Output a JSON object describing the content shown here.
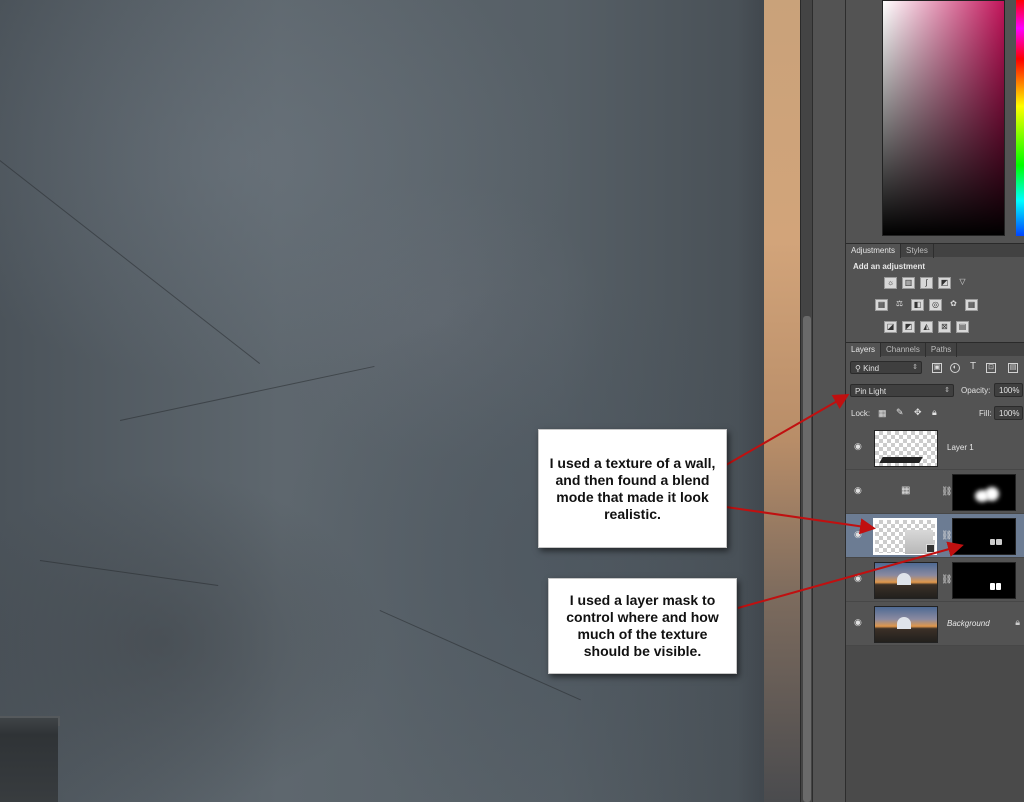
{
  "adjustments": {
    "tabs": [
      "Adjustments",
      "Styles"
    ],
    "title": "Add an adjustment",
    "icon_rows": [
      [
        "brightness-contrast-icon",
        "levels-icon",
        "curves-icon",
        "exposure-icon",
        "vibrance-icon"
      ],
      [
        "hue-saturation-icon",
        "color-balance-icon",
        "black-white-icon",
        "photo-filter-icon",
        "channel-mixer-icon",
        "color-lookup-icon"
      ],
      [
        "invert-icon",
        "posterize-icon",
        "threshold-icon",
        "selective-color-icon",
        "gradient-map-icon"
      ]
    ]
  },
  "layers_panel": {
    "tabs": [
      "Layers",
      "Channels",
      "Paths"
    ],
    "filter_kind": "Kind",
    "blend_mode": "Pin Light",
    "opacity_label": "Opacity:",
    "opacity_value": "100%",
    "lock_label": "Lock:",
    "fill_label": "Fill:",
    "fill_value": "100%",
    "layers": [
      {
        "name": "Layer 1",
        "type": "pixel"
      },
      {
        "name": "",
        "type": "adjustment-with-mask"
      },
      {
        "name": "",
        "type": "smart-object-with-mask",
        "selected": true
      },
      {
        "name": "",
        "type": "photo-with-mask"
      },
      {
        "name": "Background",
        "type": "background",
        "locked": true
      }
    ]
  },
  "callouts": {
    "texture": "I used a texture of a wall, and then found a blend mode that made it look realistic.",
    "mask": "I used a layer mask to control where and how much of the texture should be visible."
  },
  "colors": {
    "panel_bg": "#535353",
    "selected_layer": "#6c7c93",
    "arrow_red": "#c01010",
    "color_field_hue": "#c2145a"
  }
}
